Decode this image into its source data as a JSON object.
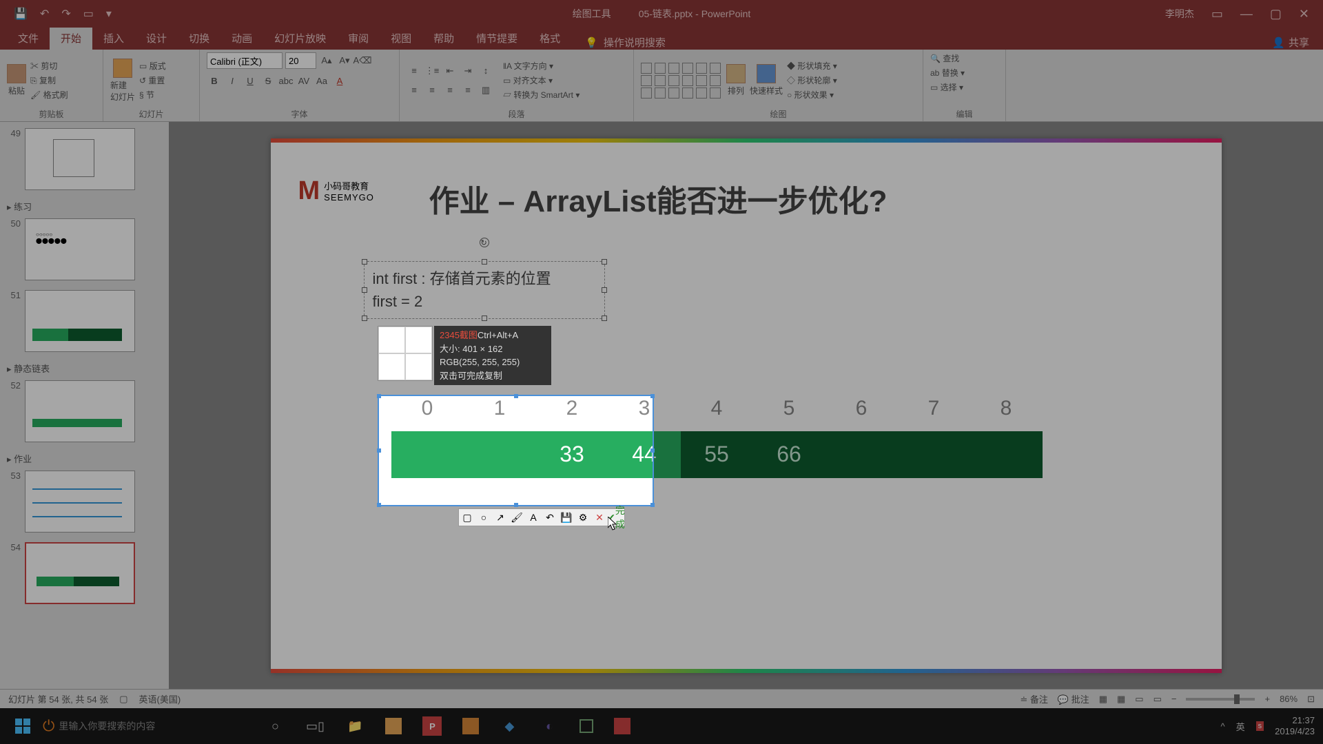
{
  "titlebar": {
    "tools_label": "绘图工具",
    "doc_title": "05-链表.pptx - PowerPoint",
    "user": "李明杰"
  },
  "tabs": {
    "file": "文件",
    "home": "开始",
    "insert": "插入",
    "design": "设计",
    "transitions": "切换",
    "animations": "动画",
    "slideshow": "幻灯片放映",
    "review": "审阅",
    "view": "视图",
    "help": "帮助",
    "plot": "情节提要",
    "format": "格式",
    "search_placeholder": "操作说明搜索",
    "share": "共享"
  },
  "ribbon": {
    "clipboard": {
      "label": "剪贴板",
      "paste": "粘贴",
      "cut": "剪切",
      "copy": "复制",
      "formatpainter": "格式刷"
    },
    "slides": {
      "label": "幻灯片",
      "newslide": "新建\n幻灯片",
      "layout": "版式",
      "reset": "重置",
      "section": "节"
    },
    "font": {
      "label": "字体",
      "name": "Calibri (正文)",
      "size": "20"
    },
    "paragraph": {
      "label": "段落",
      "textdir": "文字方向",
      "align": "对齐文本",
      "smartart": "转换为 SmartArt"
    },
    "drawing": {
      "label": "绘图",
      "arrange": "排列",
      "quickstyle": "快速样式",
      "fill": "形状填充",
      "outline": "形状轮廓",
      "effects": "形状效果"
    },
    "editing": {
      "label": "编辑",
      "find": "查找",
      "replace": "替换",
      "select": "选择"
    }
  },
  "sections": {
    "practice": "练习",
    "staticlist": "静态链表",
    "homework": "作业"
  },
  "thumbs": {
    "n49": "49",
    "n50": "50",
    "n51": "51",
    "n52": "52",
    "n53": "53",
    "n54": "54"
  },
  "slide": {
    "logo_small": "小码哥教育",
    "logo_en": "SEEMYGO",
    "title": "作业 – ArrayList能否进一步优化?",
    "text1": "int first : 存储首元素的位置",
    "text2": "first = 2",
    "indices": [
      "0",
      "1",
      "2",
      "3",
      "4",
      "5",
      "6",
      "7",
      "8"
    ],
    "cells": [
      "",
      "",
      "33",
      "44",
      "55",
      "66",
      "",
      "",
      ""
    ]
  },
  "capture": {
    "title": "2345截图",
    "shortcut": "Ctrl+Alt+A",
    "size_label": "大小:",
    "size_val": "401 × 162",
    "rgb": "RGB(255, 255, 255)",
    "hint": "双击可完成复制",
    "done": "完成"
  },
  "status": {
    "slide_info": "幻灯片 第 54 张, 共 54 张",
    "lang": "英语(美国)",
    "notes": "备注",
    "comments": "批注",
    "zoom": "86%"
  },
  "taskbar": {
    "search": "里输入你要搜索的内容",
    "ime": "英",
    "time": "21:37",
    "date": "2019/4/23"
  }
}
